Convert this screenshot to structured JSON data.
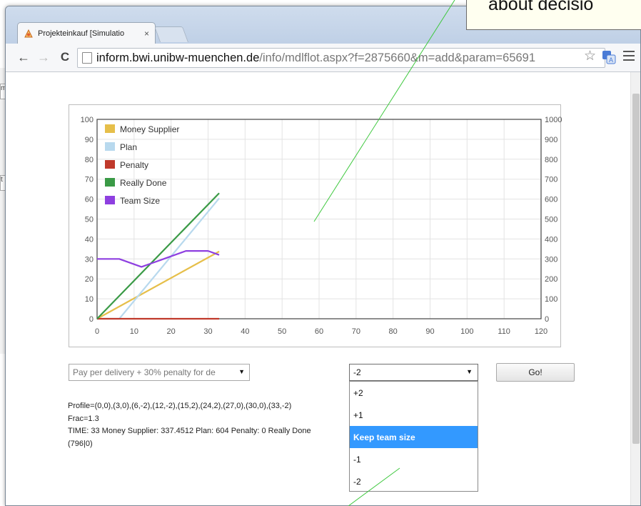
{
  "callout": {
    "text": "about decisio"
  },
  "browser": {
    "tab_title": "Projekteinkauf [Simulatio",
    "tab_close": "×",
    "url_host": "inform.bwi.unibw-muenchen.de",
    "url_path": "/info/mdlflot.aspx?f=2875660&m=add&param=65691"
  },
  "bg_window": {
    "label_a": "m",
    "label_b": "t"
  },
  "chart_data": {
    "type": "line",
    "x_ticks": [
      0,
      10,
      20,
      30,
      40,
      50,
      60,
      70,
      80,
      90,
      100,
      110,
      120
    ],
    "y_left_ticks": [
      0,
      10,
      20,
      30,
      40,
      50,
      60,
      70,
      80,
      90,
      100
    ],
    "y_right_ticks": [
      0,
      100,
      200,
      300,
      400,
      500,
      600,
      700,
      800,
      900,
      1000
    ],
    "xlim": [
      0,
      120
    ],
    "ylim_left": [
      0,
      100
    ],
    "ylim_right": [
      0,
      1000
    ],
    "grid": true,
    "legend_position": "top-left",
    "series": [
      {
        "name": "Money Supplier",
        "color": "#e6bf4a",
        "axis": "right",
        "x": [
          0,
          33
        ],
        "y": [
          0,
          337.45
        ]
      },
      {
        "name": "Plan",
        "color": "#b8d9ee",
        "axis": "right",
        "x": [
          0,
          4,
          6,
          33
        ],
        "y": [
          0,
          0,
          0,
          604
        ]
      },
      {
        "name": "Penalty",
        "color": "#c0392b",
        "axis": "right",
        "x": [
          0,
          33
        ],
        "y": [
          0,
          0
        ]
      },
      {
        "name": "Really Done",
        "color": "#3a9a46",
        "axis": "right",
        "x": [
          0,
          33
        ],
        "y": [
          0,
          630
        ]
      },
      {
        "name": "Team Size",
        "color": "#8e3fe0",
        "axis": "left",
        "x": [
          0,
          6,
          12,
          15,
          18,
          24,
          30,
          33
        ],
        "y": [
          30,
          30,
          26,
          28,
          30,
          34,
          34,
          32
        ]
      }
    ]
  },
  "controls": {
    "strategy_select": "Pay per delivery + 30% penalty for de",
    "team_select": "-2",
    "go_label": "Go!",
    "dropdown_options": [
      "+2",
      "+1",
      "Keep team size",
      "-1",
      "-2"
    ],
    "dropdown_highlighted": "Keep team size"
  },
  "info": {
    "profile": "Profile=(0,0),(3,0),(6,-2),(12,-2),(15,2),(24,2),(27,0),(30,0),(33,-2)",
    "frac": "Frac=1.3",
    "time": "TIME: 33 Money Supplier: 337.4512 Plan: 604 Penalty: 0 Really Done",
    "tail": "(796|0)"
  }
}
